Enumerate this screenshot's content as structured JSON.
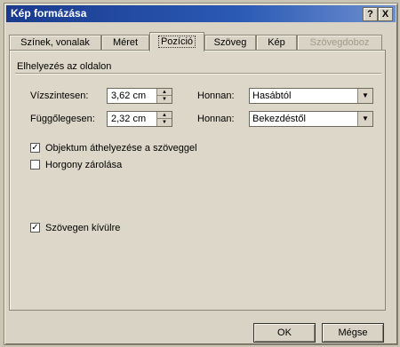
{
  "window": {
    "title": "Kép formázása",
    "help_label": "?",
    "close_label": "X"
  },
  "tabs": [
    {
      "label": "Színek, vonalak"
    },
    {
      "label": "Méret"
    },
    {
      "label": "Pozíció"
    },
    {
      "label": "Szöveg"
    },
    {
      "label": "Kép"
    },
    {
      "label": "Szövegdoboz"
    }
  ],
  "active_tab": "Pozíció",
  "group": {
    "label": "Elhelyezés az oldalon"
  },
  "horizontal": {
    "label": "Vízszintesen:",
    "value": "3,62 cm",
    "from_label": "Honnan:",
    "from_value": "Hasábtól"
  },
  "vertical": {
    "label": "Függőlegesen:",
    "value": "2,32 cm",
    "from_label": "Honnan:",
    "from_value": "Bekezdéstől"
  },
  "checkboxes": {
    "move_with_text": {
      "label": "Objektum áthelyezése a szöveggel",
      "checked": true,
      "mark": "✓"
    },
    "lock_anchor": {
      "label": "Horgony zárolása",
      "checked": false
    },
    "float_over_text": {
      "label": "Szövegen kívülre",
      "checked": true,
      "mark": "✓"
    }
  },
  "buttons": {
    "ok_label": "OK",
    "cancel_label": "Mégse"
  },
  "icons": {
    "spin_up": "▲",
    "spin_down": "▼",
    "dropdown": "▼"
  },
  "colors": {
    "title_bar": "#1a3a8e",
    "dialog_face": "#d8d3c4"
  }
}
